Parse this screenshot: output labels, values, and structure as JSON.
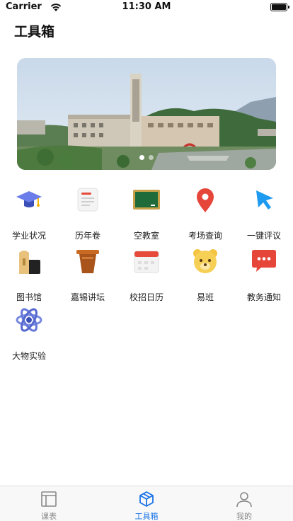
{
  "status_bar": {
    "carrier": "Carrier",
    "time": "11:30 AM"
  },
  "header": {
    "title": "工具箱"
  },
  "banner": {
    "slide_count": 2,
    "active_slide": 1
  },
  "tools": [
    {
      "label": "学业状况",
      "icon": "graduation-cap-icon"
    },
    {
      "label": "历年卷",
      "icon": "document-icon"
    },
    {
      "label": "空教室",
      "icon": "blackboard-icon"
    },
    {
      "label": "考场查询",
      "icon": "location-pin-icon"
    },
    {
      "label": "一键评议",
      "icon": "cursor-icon"
    },
    {
      "label": "图书馆",
      "icon": "library-icon"
    },
    {
      "label": "嘉锡讲坛",
      "icon": "podium-icon"
    },
    {
      "label": "校招日历",
      "icon": "calendar-icon"
    },
    {
      "label": "易班",
      "icon": "bear-icon"
    },
    {
      "label": "教务通知",
      "icon": "message-icon"
    },
    {
      "label": "大物实验",
      "icon": "atom-icon"
    }
  ],
  "tab_bar": {
    "items": [
      {
        "label": "课表",
        "icon": "schedule-icon",
        "active": false
      },
      {
        "label": "工具箱",
        "icon": "toolbox-icon",
        "active": true
      },
      {
        "label": "我的",
        "icon": "profile-icon",
        "active": false
      }
    ]
  },
  "colors": {
    "accent": "#1a73e8",
    "tab_inactive": "#888888"
  }
}
